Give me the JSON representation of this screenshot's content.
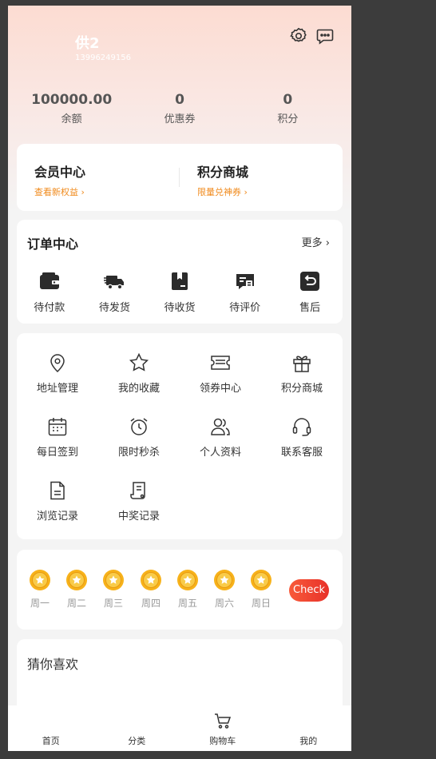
{
  "profile": {
    "name": "供2",
    "phone": "13996249156"
  },
  "header": {
    "settings_icon": "gear-icon",
    "message_icon": "message-icon"
  },
  "stats": [
    {
      "value": "100000.00",
      "label": "余额"
    },
    {
      "value": "0",
      "label": "优惠券"
    },
    {
      "value": "0",
      "label": "积分"
    }
  ],
  "member": {
    "left": {
      "title": "会员中心",
      "subtitle": "查看新权益"
    },
    "right": {
      "title": "积分商城",
      "subtitle": "限量兑神券"
    }
  },
  "orders": {
    "title": "订单中心",
    "more": "更多",
    "items": [
      {
        "label": "待付款",
        "icon": "wallet-icon"
      },
      {
        "label": "待发货",
        "icon": "truck-icon"
      },
      {
        "label": "待收货",
        "icon": "package-icon"
      },
      {
        "label": "待评价",
        "icon": "comment-icon"
      },
      {
        "label": "售后",
        "icon": "return-icon"
      }
    ]
  },
  "tools": [
    {
      "label": "地址管理",
      "icon": "location-icon"
    },
    {
      "label": "我的收藏",
      "icon": "star-icon"
    },
    {
      "label": "领券中心",
      "icon": "ticket-icon"
    },
    {
      "label": "积分商城",
      "icon": "gift-icon"
    },
    {
      "label": "每日签到",
      "icon": "calendar-icon"
    },
    {
      "label": "限时秒杀",
      "icon": "alarm-icon"
    },
    {
      "label": "个人资料",
      "icon": "users-icon"
    },
    {
      "label": "联系客服",
      "icon": "headset-icon"
    },
    {
      "label": "浏览记录",
      "icon": "document-icon"
    },
    {
      "label": "中奖记录",
      "icon": "scroll-icon"
    }
  ],
  "signin": {
    "days": [
      "周一",
      "周二",
      "周三",
      "周四",
      "周五",
      "周六",
      "周日"
    ],
    "button": "Check"
  },
  "guess": {
    "title": "猜你喜欢"
  },
  "tabbar": [
    {
      "label": "首页"
    },
    {
      "label": "分类"
    },
    {
      "label": "购物车",
      "icon": "cart-icon"
    },
    {
      "label": "我的"
    }
  ],
  "colors": {
    "accent": "#f08a1c",
    "check_button": "#ea3a2c",
    "header_gradient_top": "#fcdcd2"
  }
}
